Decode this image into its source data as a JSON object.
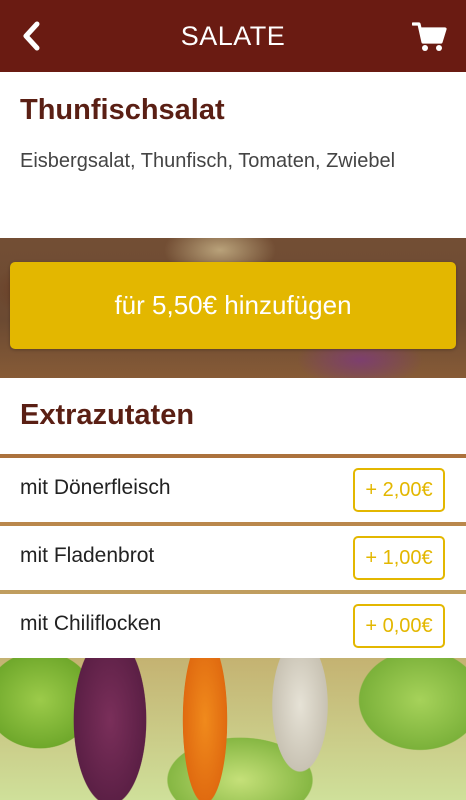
{
  "header": {
    "title": "SALATE",
    "back_icon": "chevron-left-icon",
    "cart_icon": "shopping-cart-icon",
    "color": "#6a1b12"
  },
  "product": {
    "name": "Thunfischsalat",
    "description": "Eisbergsalat, Thunfisch, Tomaten, Zwiebel"
  },
  "add_button": {
    "label": "für 5,50€ hinzufügen",
    "color": "#e3b700"
  },
  "extras": {
    "title": "Extrazutaten",
    "items": [
      {
        "label": "mit Dönerfleisch",
        "price": "+ 2,00€"
      },
      {
        "label": "mit Fladenbrot",
        "price": "+ 1,00€"
      },
      {
        "label": "mit Chiliflocken",
        "price": "+ 0,00€"
      }
    ]
  }
}
